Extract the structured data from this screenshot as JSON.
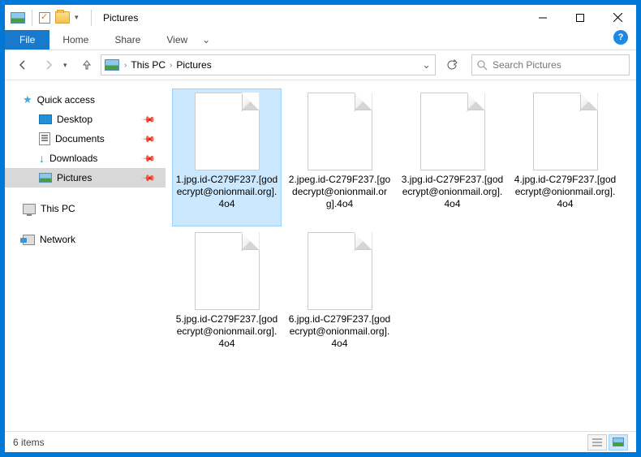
{
  "window": {
    "title": "Pictures"
  },
  "ribbon": {
    "file": "File",
    "tabs": [
      "Home",
      "Share",
      "View"
    ]
  },
  "breadcrumb": {
    "parts": [
      "This PC",
      "Pictures"
    ]
  },
  "search": {
    "placeholder": "Search Pictures"
  },
  "nav": {
    "quick_access": "Quick access",
    "items": [
      {
        "label": "Desktop",
        "pinned": true
      },
      {
        "label": "Documents",
        "pinned": true
      },
      {
        "label": "Downloads",
        "pinned": true
      },
      {
        "label": "Pictures",
        "pinned": true,
        "selected": true
      }
    ],
    "this_pc": "This PC",
    "network": "Network"
  },
  "files": [
    {
      "name": "1.jpg.id-C279F237.[godecrypt@onionmail.org].4o4",
      "selected": true
    },
    {
      "name": "2.jpeg.id-C279F237.[godecrypt@onionmail.org].4o4"
    },
    {
      "name": "3.jpg.id-C279F237.[godecrypt@onionmail.org].4o4"
    },
    {
      "name": "4.jpg.id-C279F237.[godecrypt@onionmail.org].4o4"
    },
    {
      "name": "5.jpg.id-C279F237.[godecrypt@onionmail.org].4o4"
    },
    {
      "name": "6.jpg.id-C279F237.[godecrypt@onionmail.org].4o4"
    }
  ],
  "status": {
    "count": "6 items"
  }
}
